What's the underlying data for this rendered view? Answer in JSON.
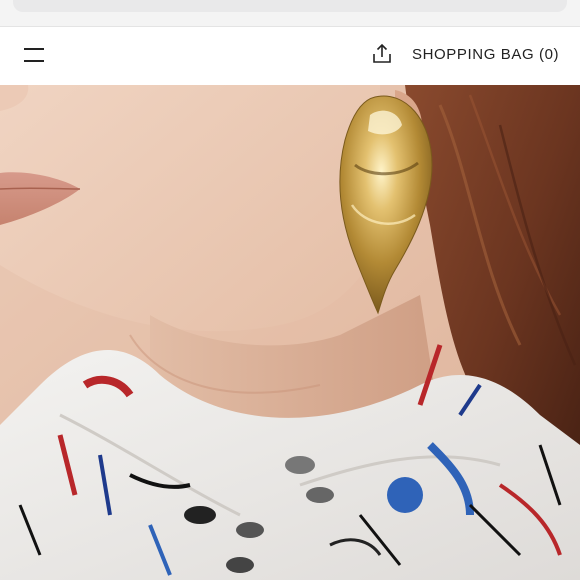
{
  "header": {
    "bag_label": "SHOPPING BAG (0)",
    "menu_icon": "hamburger-menu-icon",
    "share_icon": "share-upload-icon"
  },
  "hero": {
    "icon": "product-photo-earring"
  },
  "colors": {
    "text": "#222222",
    "header_bg": "#ffffff",
    "skin": "#e9c9b4",
    "gold": "#c9a24a",
    "hair": "#6b3520"
  }
}
